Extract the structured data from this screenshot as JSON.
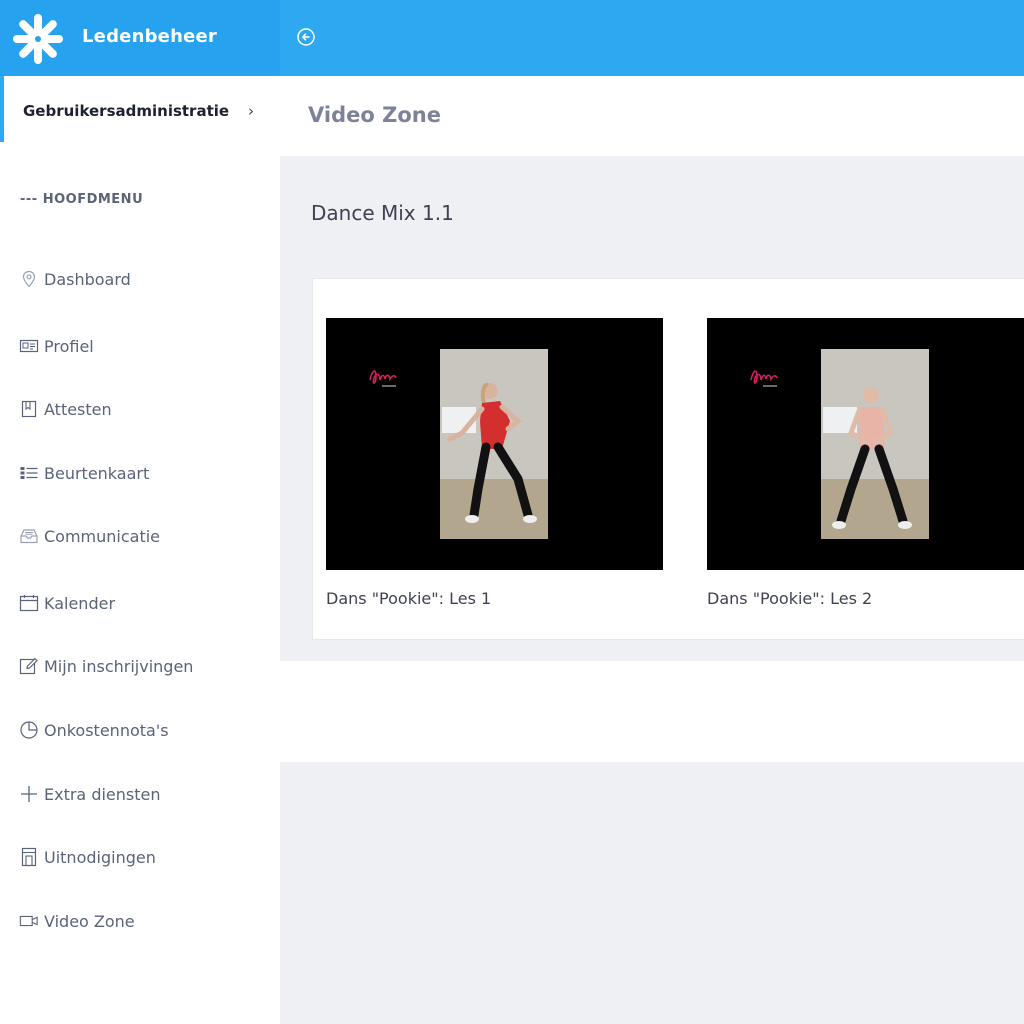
{
  "app": {
    "brand_name": "Ledenbeheer",
    "accent_color": "#2ea9f1"
  },
  "sidebar": {
    "subheader": "Gebruikersadministratie",
    "subheader_chevron": "›",
    "section_title": "--- HOOFDMENU",
    "items": [
      {
        "label": "Dashboard",
        "icon": "map-pin-icon"
      },
      {
        "label": "Profiel",
        "icon": "id-card-icon"
      },
      {
        "label": "Attesten",
        "icon": "bookmark-icon"
      },
      {
        "label": "Beurtenkaart",
        "icon": "list-icon"
      },
      {
        "label": "Communicatie",
        "icon": "inbox-icon"
      },
      {
        "label": "Kalender",
        "icon": "calendar-icon"
      },
      {
        "label": "Mijn inschrijvingen",
        "icon": "edit-icon"
      },
      {
        "label": "Onkostennota's",
        "icon": "pie-chart-icon"
      },
      {
        "label": "Extra diensten",
        "icon": "plus-icon"
      },
      {
        "label": "Uitnodigingen",
        "icon": "door-icon"
      },
      {
        "label": "Video Zone",
        "icon": "video-camera-icon"
      }
    ]
  },
  "page": {
    "title": "Video Zone",
    "section_title": "Dance Mix 1.1"
  },
  "videos": [
    {
      "caption": "Dans \"Pookie\": Les 1",
      "shirt_color": "#d32f2f"
    },
    {
      "caption": "Dans \"Pookie\": Les 2",
      "shirt_color": "#e8b4a8"
    }
  ]
}
